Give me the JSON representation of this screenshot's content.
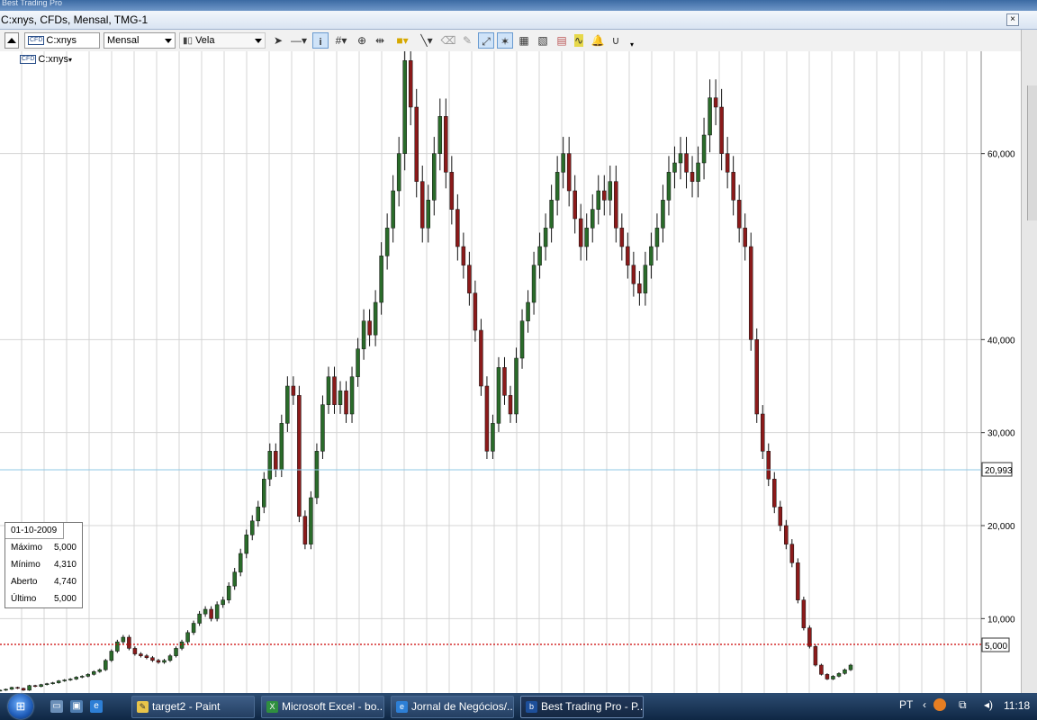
{
  "window": {
    "top_strip_text": "Best Trading Pro",
    "title": "C:xnys, CFDs, Mensal, TMG-1",
    "close_glyph": "×"
  },
  "toolbar": {
    "symbol_value": "C:xnys",
    "symbol_tag": "CFD",
    "period_value": "Mensal",
    "chart_style_value": "Vela",
    "tools": [
      "pointer-tool",
      "line-style-tool",
      "info-tool",
      "grid-tool",
      "zoom-tool",
      "scale-tool",
      "color-tool",
      "draw-line-tool",
      "eraser-tool",
      "delete-drawing-tool",
      "autoscale-tool",
      "magnet-tool",
      "indicator-tool",
      "compare-tool",
      "export-tool",
      "alert-tool",
      "horseshoe-tool"
    ]
  },
  "chart": {
    "symbol_label": "C:xnys",
    "symbol_tag": "CFD",
    "price_labels": [
      "60,000",
      "40,000",
      "30,000",
      "20,000",
      "10,000"
    ],
    "crosshair_value": "20,993",
    "last_price_value": "5,000"
  },
  "infobox": {
    "date": "01-10-2009",
    "rows": [
      {
        "label": "Máximo",
        "value": "5,000"
      },
      {
        "label": "Mínimo",
        "value": "4,310"
      },
      {
        "label": "Aberto",
        "value": "4,740"
      },
      {
        "label": "Último",
        "value": "5,000"
      }
    ]
  },
  "taskbar": {
    "tasks": [
      {
        "label": "target2 - Paint",
        "icon": "paint-icon"
      },
      {
        "label": "Microsoft Excel - bo...",
        "icon": "excel-icon"
      },
      {
        "label": "Jornal de Negócios/...",
        "icon": "ie-icon"
      },
      {
        "label": "Best Trading Pro - P...",
        "icon": "btp-icon"
      }
    ],
    "language": "PT",
    "clock": "11:18"
  },
  "colors": {
    "bull": "#2a6b2a",
    "bear": "#8b1a1a",
    "crosshair": "#8fc9e6",
    "lastprice": "#cc0000",
    "grid": "#d4d4d4"
  },
  "chart_data": {
    "type": "candlestick",
    "ylim": [
      2000,
      71000
    ],
    "series": [
      {
        "approx_close": [
          2300,
          2400,
          2600,
          2500,
          2300,
          2800,
          2700,
          2900,
          3000,
          3100,
          3300,
          3400,
          3500,
          3700,
          3800,
          4000,
          4300,
          4500,
          5500,
          6500,
          7500,
          8000,
          6800,
          6200,
          6000,
          5800,
          5500,
          5300,
          5500,
          6000,
          6800,
          7500,
          8500,
          9500,
          10500,
          11000,
          10000,
          11500,
          12000,
          13500,
          15000,
          17000,
          19000,
          20500,
          22000,
          25000,
          28000,
          26000,
          31000,
          35000,
          34000,
          21000,
          18000,
          23000,
          28000,
          33000,
          36000,
          33000,
          34500,
          32000,
          36000,
          39000,
          42000,
          40500,
          44000,
          49000,
          52000,
          56000,
          60000,
          70000,
          65000,
          57000,
          52000,
          55000,
          60000,
          64000,
          58000,
          54000,
          50000,
          48000,
          45000,
          41000,
          35000,
          28000,
          31000,
          37000,
          34000,
          32000,
          38000,
          42000,
          44000,
          48000,
          50000,
          52000,
          55000,
          58000,
          60000,
          56000,
          53000,
          50000,
          52000,
          54000,
          56000,
          55000,
          57000,
          52000,
          50000,
          48000,
          46000,
          45000,
          48000,
          50000,
          52000,
          55000,
          58000,
          59000,
          60000,
          58000,
          57000,
          59000,
          62000,
          66000,
          65000,
          60000,
          58000,
          55000,
          52000,
          50000,
          40000,
          32000,
          28000,
          25000,
          22000,
          20000,
          18000,
          16000,
          12000,
          9000,
          7000,
          5000,
          4000,
          3500,
          3800,
          4100,
          4500,
          5000
        ]
      }
    ]
  }
}
